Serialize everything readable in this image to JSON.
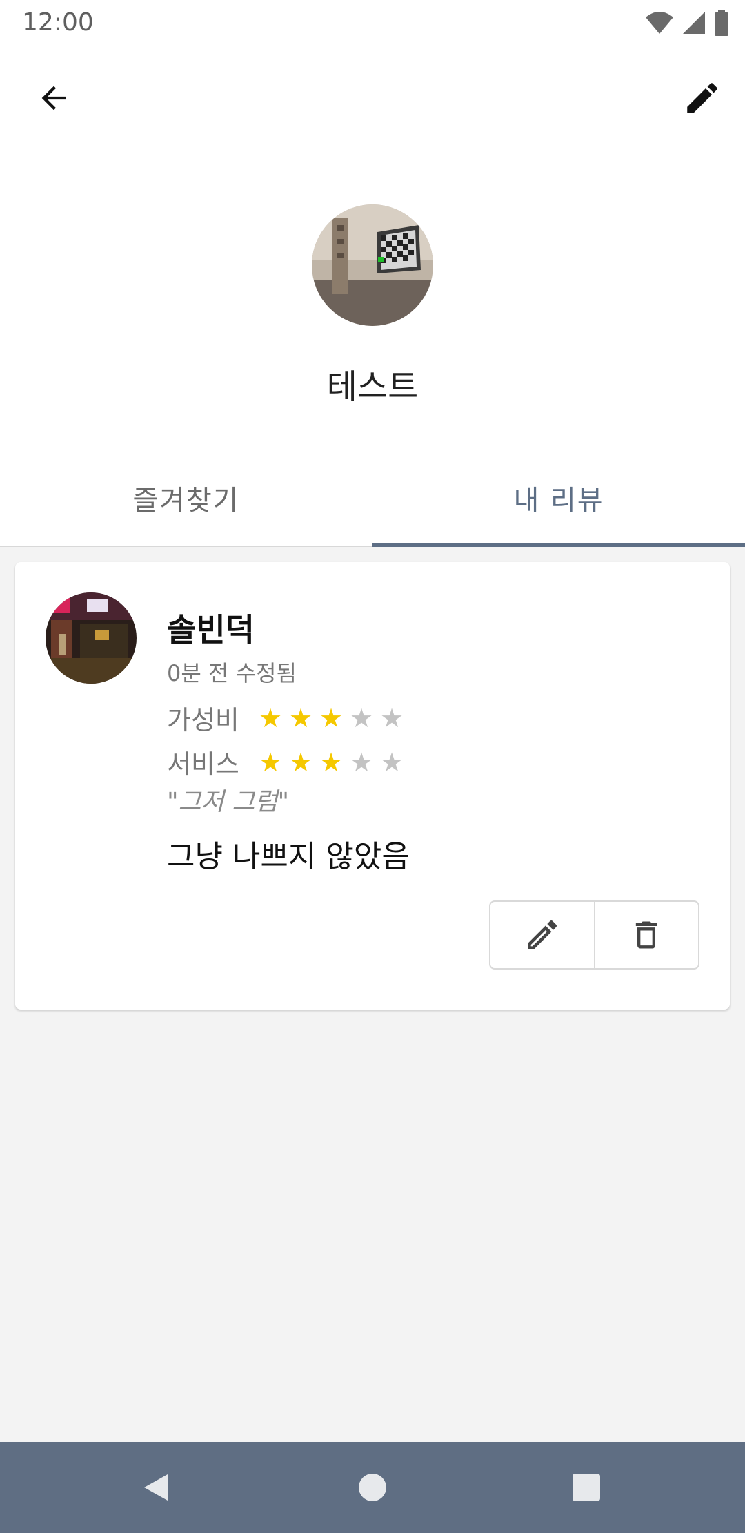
{
  "status_bar": {
    "time": "12:00",
    "icons": [
      "wifi-icon",
      "cell-signal-icon",
      "battery-icon"
    ]
  },
  "app_bar": {
    "back_icon": "arrow-back-icon",
    "edit_icon": "pencil-icon"
  },
  "profile": {
    "name": "테스트"
  },
  "tabs": [
    {
      "label": "즐겨찾기",
      "selected": false
    },
    {
      "label": "내 리뷰",
      "selected": true
    }
  ],
  "reviews": [
    {
      "place_name": "솔빈덕",
      "updated": "0분 전 수정됨",
      "ratings": [
        {
          "label": "가성비",
          "value": 3,
          "max": 5
        },
        {
          "label": "서비스",
          "value": 3,
          "max": 5
        }
      ],
      "title": "\"그저 그럼\"",
      "body": "그냥 나쁘지 않았음",
      "actions": [
        "pencil-icon",
        "trash-icon"
      ]
    }
  ],
  "colors": {
    "accent": "#5d6e85",
    "star_on": "#f5c800",
    "star_off": "#c3c3c3",
    "nav_bar": "#5f6e83",
    "content_bg": "#f3f3f3"
  }
}
